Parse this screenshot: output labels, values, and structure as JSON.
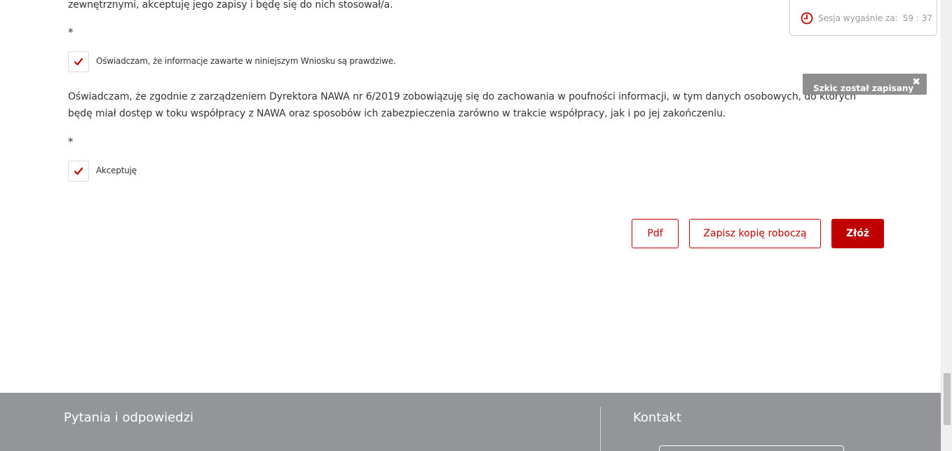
{
  "form": {
    "top_text_tail": "zewnętrznymi, akceptuję jego zapisy i będę się do nich stosował/a.",
    "required_marker": "*",
    "declaration_true_label": "Oświadczam, że informacje zawarte w niniejszym Wniosku są prawdziwe.",
    "declaration_true_checked": true,
    "confidentiality_text_line1": "Oświadczam, że zgodnie z zarządzeniem Dyrektora NAWA nr 6/2019 zobowiązuję się do zachowania w poufności informacji, w tym danych osobowych, do których",
    "confidentiality_text_line2": "będę miał dostęp w toku współpracy z NAWA oraz sposobów ich zabezpieczenia zarówno w trakcie współpracy, jak i po jej zakończeniu.",
    "accept_label": "Akceptuję",
    "accept_checked": true
  },
  "actions": {
    "pdf_label": "Pdf",
    "save_draft_label": "Zapisz kopię roboczą",
    "submit_label": "Złóż"
  },
  "session": {
    "label": "Sesja wygaśnie za:",
    "time": "59 : 37"
  },
  "toast": {
    "message": "Szkic został zapisany",
    "close_symbol": "✖"
  },
  "footer": {
    "faq_title": "Pytania i odpowiedzi",
    "contact_title": "Kontakt"
  },
  "colors": {
    "accent": "#c00000",
    "footer_bg": "#939598",
    "toast_bg": "#8e8e8e"
  }
}
